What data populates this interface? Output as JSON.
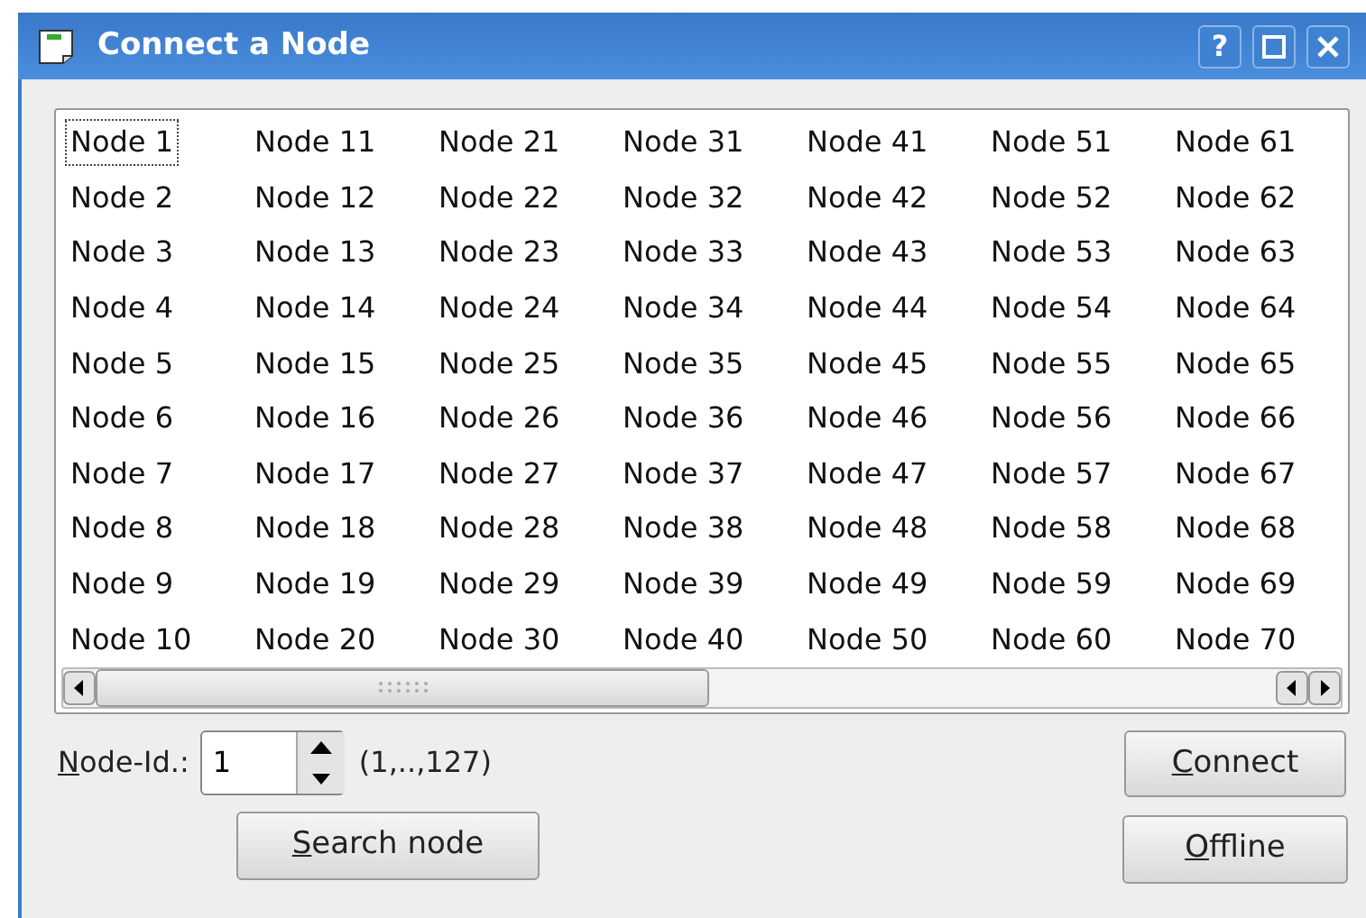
{
  "window": {
    "title": "Connect a Node",
    "buttons": [
      {
        "kind": "help",
        "label": "?"
      },
      {
        "kind": "maximize"
      },
      {
        "kind": "close"
      }
    ]
  },
  "node_list": {
    "items": [
      {
        "label": "Node 1",
        "selected": true
      },
      {
        "label": "Node 2",
        "selected": false
      },
      {
        "label": "Node 3",
        "selected": false
      },
      {
        "label": "Node 4",
        "selected": false
      },
      {
        "label": "Node 5",
        "selected": false
      },
      {
        "label": "Node 6",
        "selected": false
      },
      {
        "label": "Node 7",
        "selected": false
      },
      {
        "label": "Node 8",
        "selected": false
      },
      {
        "label": "Node 9",
        "selected": false
      },
      {
        "label": "Node 10",
        "selected": false
      },
      {
        "label": "Node 11",
        "selected": false
      },
      {
        "label": "Node 12",
        "selected": false
      },
      {
        "label": "Node 13",
        "selected": false
      },
      {
        "label": "Node 14",
        "selected": false
      },
      {
        "label": "Node 15",
        "selected": false
      },
      {
        "label": "Node 16",
        "selected": false
      },
      {
        "label": "Node 17",
        "selected": false
      },
      {
        "label": "Node 18",
        "selected": false
      },
      {
        "label": "Node 19",
        "selected": false
      },
      {
        "label": "Node 20",
        "selected": false
      },
      {
        "label": "Node 21",
        "selected": false
      },
      {
        "label": "Node 22",
        "selected": false
      },
      {
        "label": "Node 23",
        "selected": false
      },
      {
        "label": "Node 24",
        "selected": false
      },
      {
        "label": "Node 25",
        "selected": false
      },
      {
        "label": "Node 26",
        "selected": false
      },
      {
        "label": "Node 27",
        "selected": false
      },
      {
        "label": "Node 28",
        "selected": false
      },
      {
        "label": "Node 29",
        "selected": false
      },
      {
        "label": "Node 30",
        "selected": false
      },
      {
        "label": "Node 31",
        "selected": false
      },
      {
        "label": "Node 32",
        "selected": false
      },
      {
        "label": "Node 33",
        "selected": false
      },
      {
        "label": "Node 34",
        "selected": false
      },
      {
        "label": "Node 35",
        "selected": false
      },
      {
        "label": "Node 36",
        "selected": false
      },
      {
        "label": "Node 37",
        "selected": false
      },
      {
        "label": "Node 38",
        "selected": false
      },
      {
        "label": "Node 39",
        "selected": false
      },
      {
        "label": "Node 40",
        "selected": false
      },
      {
        "label": "Node 41",
        "selected": false
      },
      {
        "label": "Node 42",
        "selected": false
      },
      {
        "label": "Node 43",
        "selected": false
      },
      {
        "label": "Node 44",
        "selected": false
      },
      {
        "label": "Node 45",
        "selected": false
      },
      {
        "label": "Node 46",
        "selected": false
      },
      {
        "label": "Node 47",
        "selected": false
      },
      {
        "label": "Node 48",
        "selected": false
      },
      {
        "label": "Node 49",
        "selected": false
      },
      {
        "label": "Node 50",
        "selected": false
      },
      {
        "label": "Node 51",
        "selected": false
      },
      {
        "label": "Node 52",
        "selected": false
      },
      {
        "label": "Node 53",
        "selected": false
      },
      {
        "label": "Node 54",
        "selected": false
      },
      {
        "label": "Node 55",
        "selected": false
      },
      {
        "label": "Node 56",
        "selected": false
      },
      {
        "label": "Node 57",
        "selected": false
      },
      {
        "label": "Node 58",
        "selected": false
      },
      {
        "label": "Node 59",
        "selected": false
      },
      {
        "label": "Node 60",
        "selected": false
      },
      {
        "label": "Node 61",
        "selected": false
      },
      {
        "label": "Node 62",
        "selected": false
      },
      {
        "label": "Node 63",
        "selected": false
      },
      {
        "label": "Node 64",
        "selected": false
      },
      {
        "label": "Node 65",
        "selected": false
      },
      {
        "label": "Node 66",
        "selected": false
      },
      {
        "label": "Node 67",
        "selected": false
      },
      {
        "label": "Node 68",
        "selected": false
      },
      {
        "label": "Node 69",
        "selected": false
      },
      {
        "label": "Node 70",
        "selected": false
      }
    ]
  },
  "node_id": {
    "mnemonic": "N",
    "label_rest": "ode-Id.:",
    "value": "1",
    "range": "(1,..,127)"
  },
  "search_button": {
    "mnemonic": "S",
    "label_rest": "earch node"
  },
  "connect_button": {
    "mnemonic": "C",
    "label_rest": "onnect"
  },
  "offline_button": {
    "mnemonic": "O",
    "label_rest": "ffline"
  }
}
